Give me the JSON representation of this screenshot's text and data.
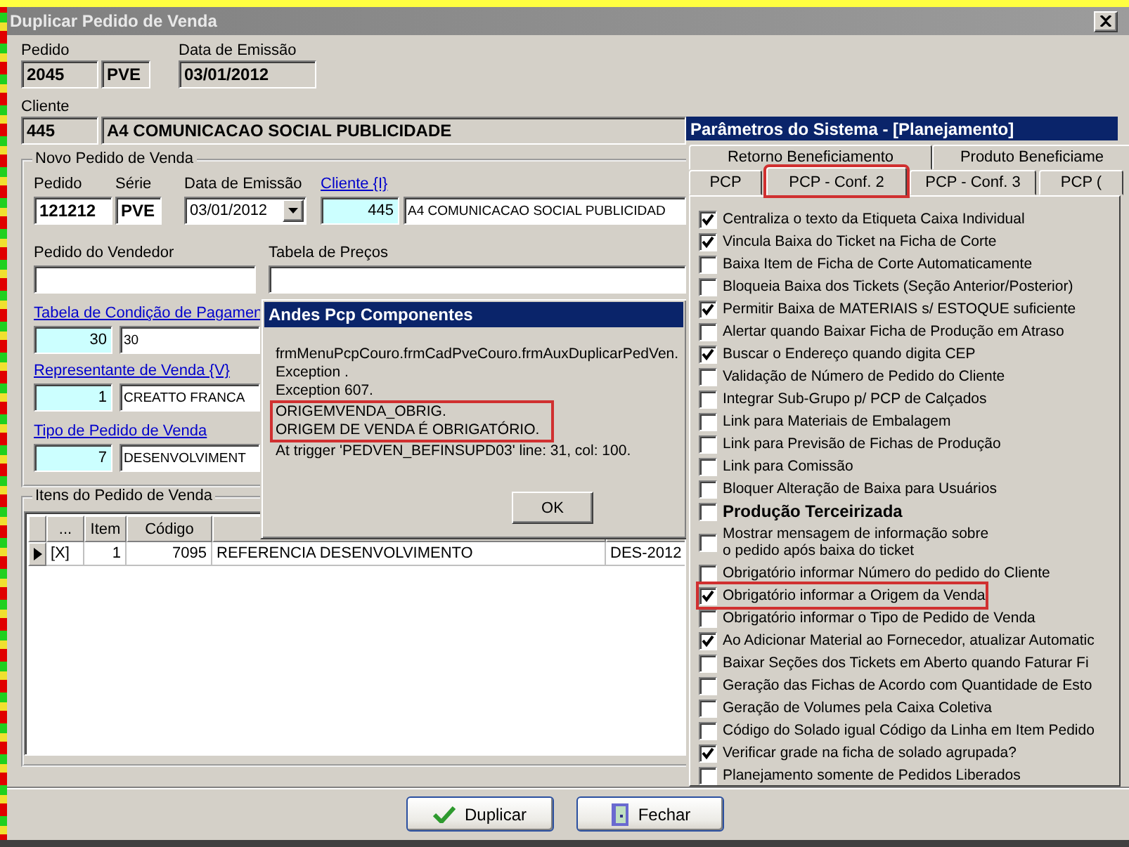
{
  "main_window": {
    "title": "Duplicar Pedido de Venda",
    "original": {
      "pedido_label": "Pedido",
      "pedido": "2045",
      "serie": "PVE",
      "data_label": "Data de Emissão",
      "data": "03/01/2012",
      "cliente_label": "Cliente",
      "cliente_codigo": "445",
      "cliente_nome": "A4 COMUNICACAO SOCIAL PUBLICIDADE"
    },
    "novo_pedido": {
      "title": "Novo Pedido de Venda",
      "pedido_label": "Pedido",
      "pedido": "121212",
      "serie_label": "Série",
      "serie": "PVE",
      "data_label": "Data de Emissão",
      "data": "03/01/2012",
      "cliente_link": "Cliente {I}",
      "cliente_codigo": "445",
      "cliente_nome": "A4 COMUNICACAO SOCIAL PUBLICIDAD",
      "vendedor_label": "Pedido do Vendedor",
      "tabela_precos_label": "Tabela de Preços",
      "condicao_link": "Tabela de Condição de Pagamen",
      "condicao_codigo": "30",
      "condicao_nome": "30",
      "representante_link": "Representante de Venda {V}",
      "representante_codigo": "1",
      "representante_nome": "CREATTO FRANCA",
      "tipo_link": "Tipo de Pedido de Venda",
      "tipo_codigo": "7",
      "tipo_nome": "DESENVOLVIMENT"
    },
    "itens": {
      "title": "Itens do Pedido de Venda",
      "columns": [
        "...",
        "Item",
        "Código"
      ],
      "rows": [
        {
          "current": true,
          "cells": [
            "[X]",
            "1",
            "7095",
            "REFERENCIA DESENVOLVIMENTO",
            "DES-2012"
          ]
        }
      ]
    },
    "buttons": [
      {
        "label": "Duplicar",
        "kind": "confirm"
      },
      {
        "label": "Fechar",
        "kind": "close"
      }
    ]
  },
  "message_box": {
    "title": "Andes Pcp Componentes",
    "lines": [
      {
        "text": "frmMenuPcpCouro.frmCadPveCouro.frmAuxDuplicarPedVen.",
        "highlighted": false
      },
      {
        "text": "Exception .",
        "highlighted": false
      },
      {
        "text": "Exception 607.",
        "highlighted": false
      },
      {
        "text": "ORIGEMVENDA_OBRIG.",
        "highlighted": true
      },
      {
        "text": "ORIGEM DE VENDA É OBRIGATÓRIO.",
        "highlighted": true
      },
      {
        "text": "At trigger 'PEDVEN_BEFINSUPD03' line: 31, col: 100.",
        "highlighted": false
      }
    ],
    "button": "OK"
  },
  "parameters_panel": {
    "title": "Parâmetros do Sistema - [Planejamento]",
    "tab_rows": [
      {
        "tabs": [
          {
            "label": "Retorno Beneficiamento",
            "selected": false,
            "highlighted": false
          },
          {
            "label": "Produto Beneficiame",
            "selected": false,
            "highlighted": false
          }
        ]
      },
      {
        "tabs": [
          {
            "label": "PCP",
            "selected": false,
            "highlighted": false
          },
          {
            "label": "PCP - Conf. 2",
            "selected": true,
            "highlighted": true
          },
          {
            "label": "PCP - Conf. 3",
            "selected": false,
            "highlighted": false
          },
          {
            "label": "PCP (",
            "selected": false,
            "highlighted": false
          }
        ]
      }
    ],
    "options": [
      {
        "label": "Centraliza o texto da Etiqueta Caixa Individual",
        "checked": true,
        "bold": false,
        "highlighted": false
      },
      {
        "label": "Vincula Baixa do Ticket na Ficha de Corte",
        "checked": true,
        "bold": false,
        "highlighted": false
      },
      {
        "label": "Baixa Item de Ficha de Corte Automaticamente",
        "checked": false,
        "bold": false,
        "highlighted": false
      },
      {
        "label": "Bloqueia Baixa dos Tickets (Seção Anterior/Posterior)",
        "checked": false,
        "bold": false,
        "highlighted": false
      },
      {
        "label": "Permitir Baixa de MATERIAIS s/ ESTOQUE suficiente",
        "checked": true,
        "bold": false,
        "highlighted": false
      },
      {
        "label": "Alertar quando Baixar Ficha de Produção em Atraso",
        "checked": false,
        "bold": false,
        "highlighted": false
      },
      {
        "label": "Buscar o Endereço quando digita CEP",
        "checked": true,
        "bold": false,
        "highlighted": false
      },
      {
        "label": "Validação de Número de Pedido do Cliente",
        "checked": false,
        "bold": false,
        "highlighted": false
      },
      {
        "label": "Integrar Sub-Grupo p/ PCP de Calçados",
        "checked": false,
        "bold": false,
        "highlighted": false
      },
      {
        "label": "Link para Materiais de Embalagem",
        "checked": false,
        "bold": false,
        "highlighted": false
      },
      {
        "label": "Link para Previsão de Fichas de Produção",
        "checked": false,
        "bold": false,
        "highlighted": false
      },
      {
        "label": "Link para Comissão",
        "checked": false,
        "bold": false,
        "highlighted": false
      },
      {
        "label": "Bloquer Alteração de Baixa para Usuários",
        "checked": false,
        "bold": false,
        "highlighted": false
      },
      {
        "label": "Produção Terceirizada",
        "checked": false,
        "bold": true,
        "highlighted": false
      },
      {
        "label": "Mostrar mensagem de informação sobre\no pedido após baixa do ticket",
        "checked": false,
        "bold": false,
        "highlighted": false
      },
      {
        "label": "Obrigatório informar Número do pedido do Cliente",
        "checked": false,
        "bold": false,
        "highlighted": false
      },
      {
        "label": "Obrigatório informar a Origem da Venda",
        "checked": true,
        "bold": false,
        "highlighted": true
      },
      {
        "label": "Obrigatório informar o Tipo de Pedido de Venda",
        "checked": false,
        "bold": false,
        "highlighted": false
      },
      {
        "label": "Ao Adicionar Material ao Fornecedor, atualizar Automatic",
        "checked": true,
        "bold": false,
        "highlighted": false
      },
      {
        "label": "Baixar Seções dos Tickets em Aberto quando Faturar Fi",
        "checked": false,
        "bold": false,
        "highlighted": false
      },
      {
        "label": "Geração das Fichas de Acordo com Quantidade de Esto",
        "checked": false,
        "bold": false,
        "highlighted": false
      },
      {
        "label": "Geração de Volumes pela Caixa Coletiva",
        "checked": false,
        "bold": false,
        "highlighted": false
      },
      {
        "label": "Código do Solado igual Código da Linha em Item Pedido",
        "checked": false,
        "bold": false,
        "highlighted": false
      },
      {
        "label": "Verificar grade na ficha de solado agrupada?",
        "checked": true,
        "bold": false,
        "highlighted": false
      },
      {
        "label": "Planejamento somente de Pedidos Liberados",
        "checked": false,
        "bold": false,
        "highlighted": false
      }
    ]
  }
}
